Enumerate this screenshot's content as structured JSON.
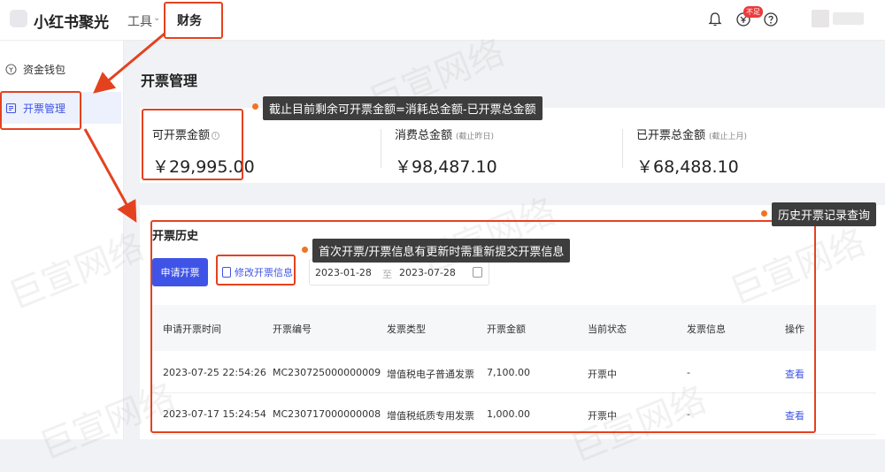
{
  "header": {
    "brand": "小红书聚光",
    "nav_tools": "工具",
    "nav_finance": "财务",
    "badge": "不足"
  },
  "sidebar": {
    "items": [
      {
        "label": "资金钱包",
        "icon": "wallet-icon"
      },
      {
        "label": "开票管理",
        "icon": "invoice-icon",
        "active": true
      }
    ]
  },
  "page": {
    "title": "开票管理"
  },
  "summary": {
    "invoiceable_label": "可开票金额",
    "invoiceable_value": "￥29,995.00",
    "consumed_label": "消费总金额",
    "consumed_note": "(截止昨日)",
    "consumed_value": "￥98,487.10",
    "invoiced_label": "已开票总金额",
    "invoiced_note": "(截止上月)",
    "invoiced_value": "￥68,488.10"
  },
  "history": {
    "title": "开票历史",
    "apply_button": "申请开票",
    "modify_button": "修改开票信息",
    "date_start": "2023-01-28",
    "date_sep": "至",
    "date_end": "2023-07-28",
    "columns": [
      "申请开票时间",
      "开票编号",
      "发票类型",
      "开票金额",
      "当前状态",
      "发票信息",
      "操作"
    ],
    "rows": [
      [
        "2023-07-25 22:54:26",
        "MC230725000000009",
        "增值税电子普通发票",
        "7,100.00",
        "开票中",
        "-",
        "查看"
      ],
      [
        "2023-07-17 15:24:54",
        "MC230717000000008",
        "增值税纸质专用发票",
        "1,000.00",
        "开票中",
        "-",
        "查看"
      ]
    ]
  },
  "annotations": {
    "tip_amount": "截止目前剩余可开票金额=消耗总金额-已开票总金额",
    "tip_history": "历史开票记录查询",
    "tip_modify": "首次开票/开票信息有更新时需重新提交开票信息"
  },
  "watermark": "巨宣网络",
  "colors": {
    "accent": "#3f54e6",
    "annotation_red": "#e4421f",
    "tooltip_bg": "#3d3d3d"
  }
}
